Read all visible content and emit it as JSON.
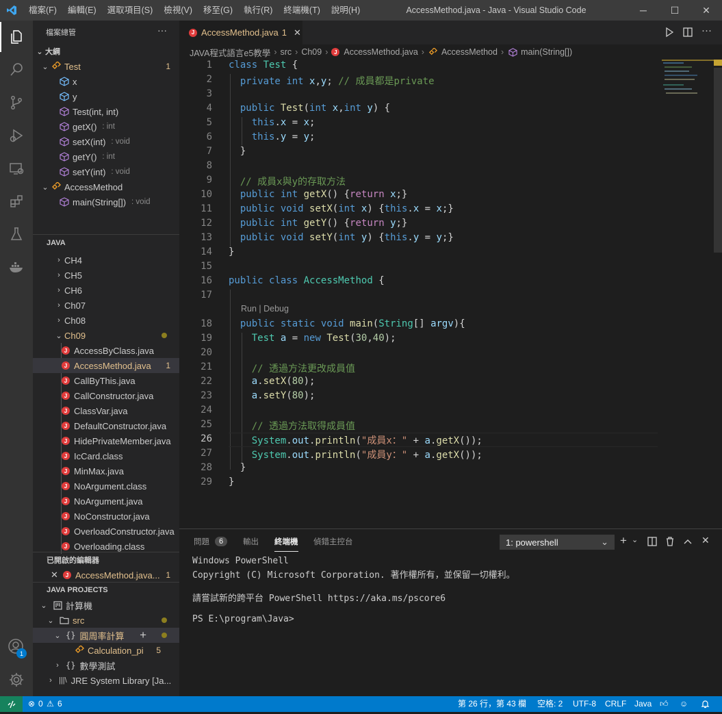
{
  "titlebar": {
    "menu": [
      "檔案(F)",
      "編輯(E)",
      "選取項目(S)",
      "檢視(V)",
      "移至(G)",
      "執行(R)",
      "終端機(T)",
      "說明(H)"
    ],
    "title": "AccessMethod.java - Java - Visual Studio Code",
    "minimize": "─",
    "maximize": "☐",
    "close": "✕"
  },
  "sidebar": {
    "header": "檔案總管",
    "more": "···",
    "outline": {
      "title": "大綱",
      "items": [
        {
          "label": "Test",
          "badge": "1"
        },
        {
          "label": "x"
        },
        {
          "label": "y"
        },
        {
          "label": "Test(int, int)"
        },
        {
          "label": "getX()",
          "detail": ": int"
        },
        {
          "label": "setX(int)",
          "detail": ": void"
        },
        {
          "label": "getY()",
          "detail": ": int"
        },
        {
          "label": "setY(int)",
          "detail": ": void"
        },
        {
          "label": "AccessMethod"
        },
        {
          "label": "main(String[])",
          "detail": ": void"
        }
      ]
    },
    "java": {
      "title": "JAVA",
      "folders": [
        "CH4",
        "CH5",
        "CH6",
        "Ch07",
        "Ch08",
        "Ch09"
      ],
      "files": [
        "AccessByClass.java",
        "AccessMethod.java",
        "CallByThis.java",
        "CallConstructor.java",
        "ClassVar.java",
        "DefaultConstructor.java",
        "HidePrivateMember.java",
        "IcCard.class",
        "MinMax.java",
        "NoArgument.class",
        "NoArgument.java",
        "NoConstructor.java",
        "OverloadConstructor.java",
        "Overloading.class"
      ],
      "active_badge": "1"
    },
    "open_editors": {
      "title": "已開啟的編輯器",
      "file": "AccessMethod.java...",
      "badge": "1"
    },
    "java_projects": {
      "title": "JAVA PROJECTS",
      "project": "計算機",
      "src": "src",
      "pkg1": "圓周率計算",
      "cls": "Calculation_pi",
      "cls_badge": "5",
      "pkg2": "數學測試",
      "lib": "JRE System Library [Ja..."
    }
  },
  "editor": {
    "tab_label": "AccessMethod.java",
    "tab_badge": "1",
    "breadcrumb": [
      "JAVA程式語言e5教學",
      "src",
      "Ch09",
      "AccessMethod.java",
      "AccessMethod",
      "main(String[])"
    ],
    "codelens": "Run | Debug"
  },
  "panel": {
    "tabs": [
      "問題",
      "輸出",
      "終端機",
      "偵錯主控台"
    ],
    "problems_count": "6",
    "terminal_select": "1: powershell",
    "terminal": [
      "Windows PowerShell",
      "Copyright (C) Microsoft Corporation. 著作權所有，並保留一切權利。",
      "",
      "請嘗試新的跨平台 PowerShell https://aka.ms/pscore6",
      "",
      "PS E:\\program\\Java>"
    ]
  },
  "statusbar": {
    "errors": "0",
    "warnings": "6",
    "position": "第 26 行，第 43 欄",
    "spaces": "空格: 2",
    "encoding": "UTF-8",
    "eol": "CRLF",
    "language": "Java"
  },
  "colors": {
    "accent": "#007acc",
    "modified": "#e2c08d",
    "error": "#e03c3c"
  }
}
